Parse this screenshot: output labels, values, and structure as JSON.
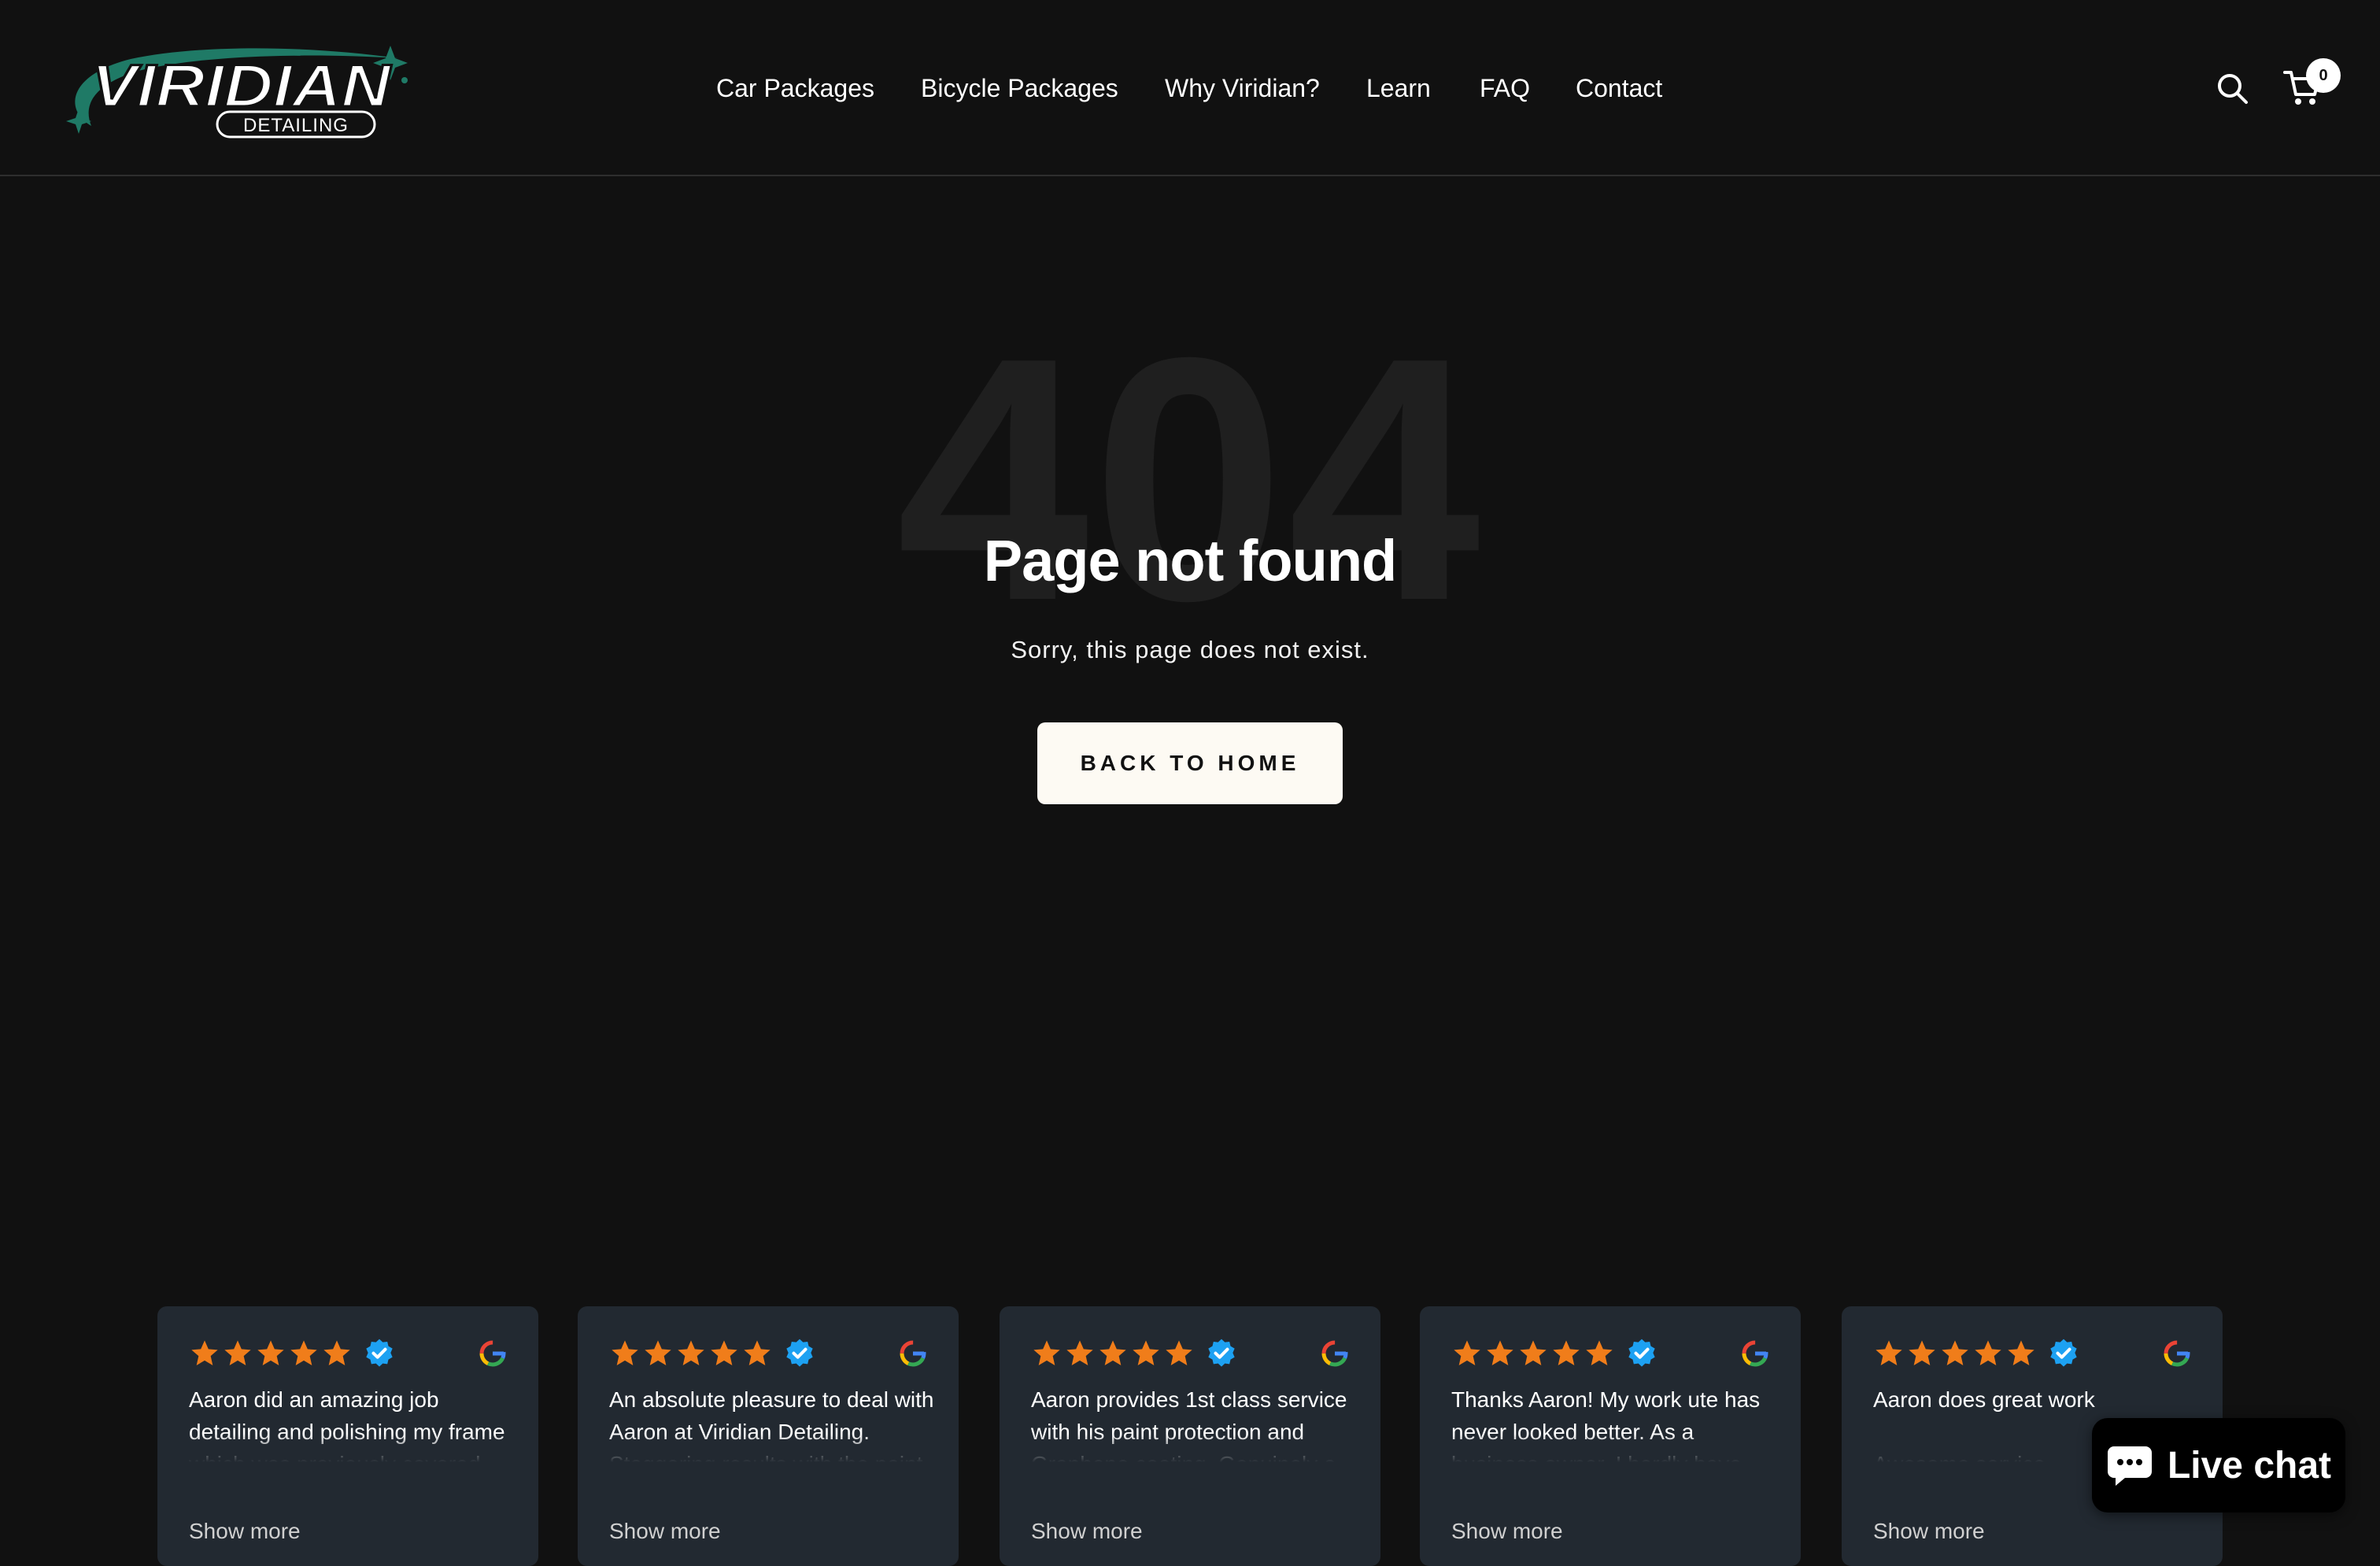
{
  "header": {
    "logo_word": "VIRIDIAN",
    "logo_sub": "DETAILING",
    "nav": [
      {
        "label": "Car Packages"
      },
      {
        "label": "Bicycle Packages"
      },
      {
        "label": "Why Viridian?"
      },
      {
        "label": "Learn"
      },
      {
        "label": "FAQ"
      },
      {
        "label": "Contact"
      }
    ],
    "cart_count": "0"
  },
  "hero": {
    "code": "404",
    "title": "Page not found",
    "subtitle": "Sorry, this page does not exist.",
    "button_label": "BACK TO HOME"
  },
  "reviews": [
    {
      "rating": 5,
      "text": "Aaron did an amazing job detailing and polishing my frame which was previously covered with swirl marks.",
      "more": "Show more"
    },
    {
      "rating": 5,
      "text": "An absolute pleasure to deal with Aaron at Viridian Detailing. Staggering results with the paint correction and ceramic coating",
      "more": "Show more"
    },
    {
      "rating": 5,
      "text": "Aaron provides 1st class service with his paint protection and Graphene coating. Genuinely a nice guy to talk and deal with.",
      "more": "Show more"
    },
    {
      "rating": 5,
      "text": "Thanks Aaron! My work ute has never looked better. As a business owner, I hardly have time to wash my car.",
      "more": "Show more"
    },
    {
      "rating": 5,
      "text": "Aaron does great work\n\nAwesome service\nPlenty of value",
      "more": "Show more"
    }
  ],
  "live_chat": {
    "label": "Live chat"
  },
  "colors": {
    "background": "#111111",
    "brand_green": "#1f7a66",
    "star": "#f07d1a",
    "verified": "#1da1f2",
    "review_card": "#222931",
    "button": "#fdfaf3"
  },
  "icons": {
    "search": "search-icon",
    "cart": "cart-icon",
    "star": "star-icon",
    "verified": "verified-badge-icon",
    "google": "google-icon",
    "chat": "chat-bubble-icon"
  }
}
